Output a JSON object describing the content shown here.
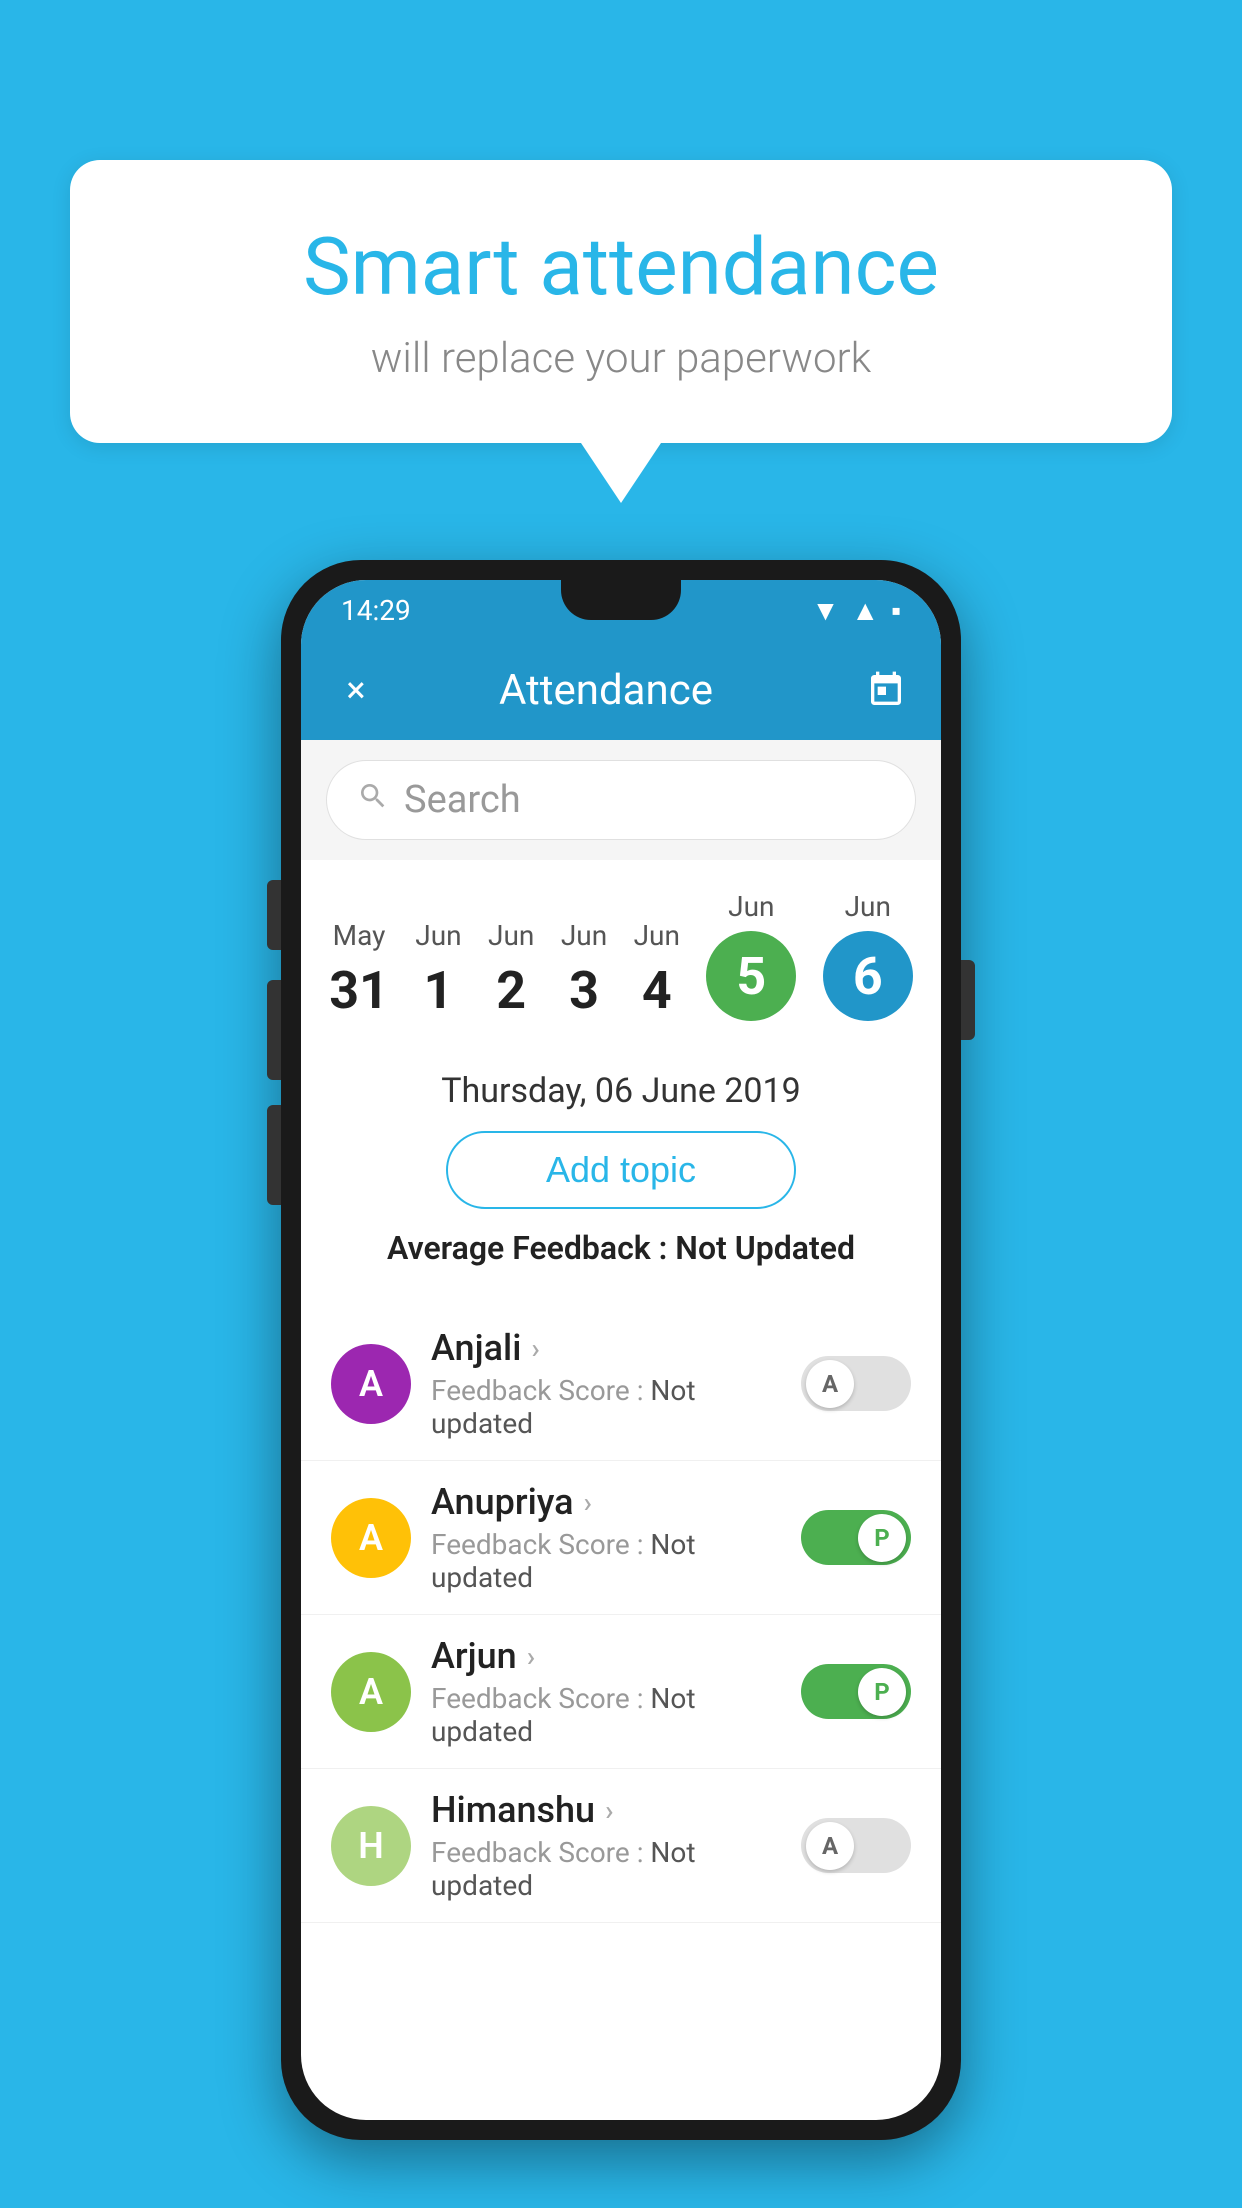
{
  "background_color": "#29b6e8",
  "speech_bubble": {
    "title": "Smart attendance",
    "subtitle": "will replace your paperwork"
  },
  "phone": {
    "status_bar": {
      "time": "14:29",
      "icons": [
        "wifi",
        "signal",
        "battery"
      ]
    },
    "app_bar": {
      "close_label": "×",
      "title": "Attendance",
      "calendar_icon": "📅"
    },
    "search": {
      "placeholder": "Search"
    },
    "dates": [
      {
        "month": "May",
        "day": "31",
        "selected": false
      },
      {
        "month": "Jun",
        "day": "1",
        "selected": false
      },
      {
        "month": "Jun",
        "day": "2",
        "selected": false
      },
      {
        "month": "Jun",
        "day": "3",
        "selected": false
      },
      {
        "month": "Jun",
        "day": "4",
        "selected": false
      },
      {
        "month": "Jun",
        "day": "5",
        "selected": "green"
      },
      {
        "month": "Jun",
        "day": "6",
        "selected": "blue"
      }
    ],
    "selected_date_text": "Thursday, 06 June 2019",
    "add_topic_label": "Add topic",
    "average_feedback_label": "Average Feedback :",
    "average_feedback_value": "Not Updated",
    "students": [
      {
        "name": "Anjali",
        "avatar_letter": "A",
        "avatar_color": "#9C27B0",
        "feedback_label": "Feedback Score :",
        "feedback_value": "Not updated",
        "toggle_state": "off",
        "toggle_letter": "A"
      },
      {
        "name": "Anupriya",
        "avatar_letter": "A",
        "avatar_color": "#FFC107",
        "feedback_label": "Feedback Score :",
        "feedback_value": "Not updated",
        "toggle_state": "on",
        "toggle_letter": "P"
      },
      {
        "name": "Arjun",
        "avatar_letter": "A",
        "avatar_color": "#8BC34A",
        "feedback_label": "Feedback Score :",
        "feedback_value": "Not updated",
        "toggle_state": "on",
        "toggle_letter": "P"
      },
      {
        "name": "Himanshu",
        "avatar_letter": "H",
        "avatar_color": "#AED581",
        "feedback_label": "Feedback Score :",
        "feedback_value": "Not updated",
        "toggle_state": "off",
        "toggle_letter": "A"
      }
    ]
  }
}
